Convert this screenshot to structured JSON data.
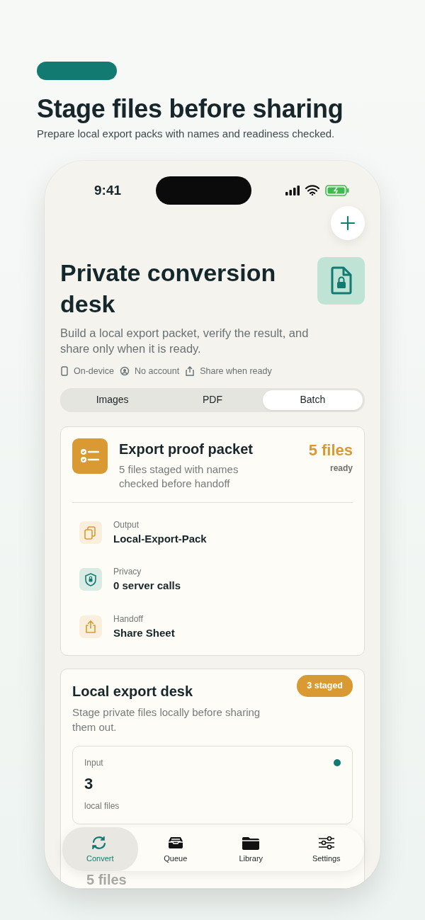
{
  "header": {
    "title": "Stage files before sharing",
    "subtitle": "Prepare local export packs with names and readiness checked."
  },
  "status_bar": {
    "time": "9:41"
  },
  "hero": {
    "title": "Private conversion desk",
    "description": "Build a local export packet, verify the result, and share only when it is ready.",
    "features": [
      {
        "kind": "device",
        "label": "On-device"
      },
      {
        "kind": "account",
        "label": "No account"
      },
      {
        "kind": "share",
        "label": "Share when ready"
      }
    ]
  },
  "segments": [
    {
      "label": "Images",
      "selected": false
    },
    {
      "label": "PDF",
      "selected": false
    },
    {
      "label": "Batch",
      "selected": true
    }
  ],
  "packet_card": {
    "title": "Export proof packet",
    "subtitle": "5 files staged with names checked before handoff",
    "count": "5 files",
    "count_note": "ready",
    "details": [
      {
        "kind": "output",
        "label": "Output",
        "value": "Local-Export-Pack"
      },
      {
        "kind": "privacy",
        "label": "Privacy",
        "value": "0 server calls"
      },
      {
        "kind": "handoff",
        "label": "Handoff",
        "value": "Share Sheet"
      }
    ]
  },
  "desk_card": {
    "title": "Local export desk",
    "description": "Stage private files locally before sharing them out.",
    "badge": "3 staged",
    "stat": {
      "label": "Input",
      "value": "3",
      "note": "local files"
    }
  },
  "peek_text": "5 files",
  "tab_bar": [
    {
      "kind": "convert",
      "label": "Convert",
      "selected": true
    },
    {
      "kind": "queue",
      "label": "Queue",
      "selected": false
    },
    {
      "kind": "library",
      "label": "Library",
      "selected": false
    },
    {
      "kind": "settings",
      "label": "Settings",
      "selected": false
    }
  ]
}
